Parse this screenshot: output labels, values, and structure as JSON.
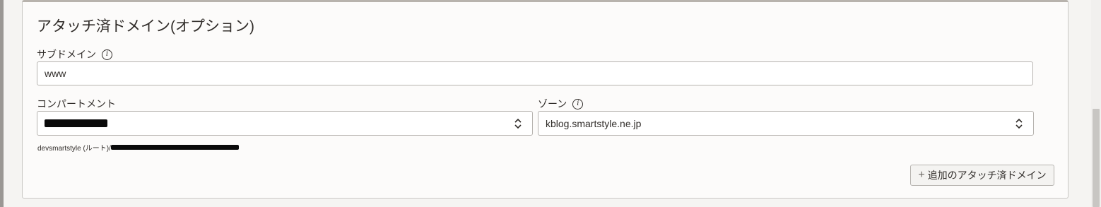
{
  "section": {
    "title": "アタッチ済ドメイン(オプション)"
  },
  "subdomain": {
    "label": "サブドメイン",
    "info_icon": "info-icon",
    "value": "www"
  },
  "compartment": {
    "label": "コンパートメント",
    "selected_value": "[redacted]",
    "path_prefix": "devsmartstyle (ルート)/",
    "path_rest": "[redacted]"
  },
  "zone": {
    "label": "ゾーン",
    "info_icon": "info-icon",
    "selected_value": "kblog.smartstyle.ne.jp"
  },
  "actions": {
    "add_plus": "+",
    "add_label": "追加のアタッチ済ドメイン"
  },
  "colors": {
    "panel_bg": "#fcfbfa",
    "border": "#b6b3af",
    "text": "#312d2a",
    "redaction": "#0a0a0a"
  }
}
